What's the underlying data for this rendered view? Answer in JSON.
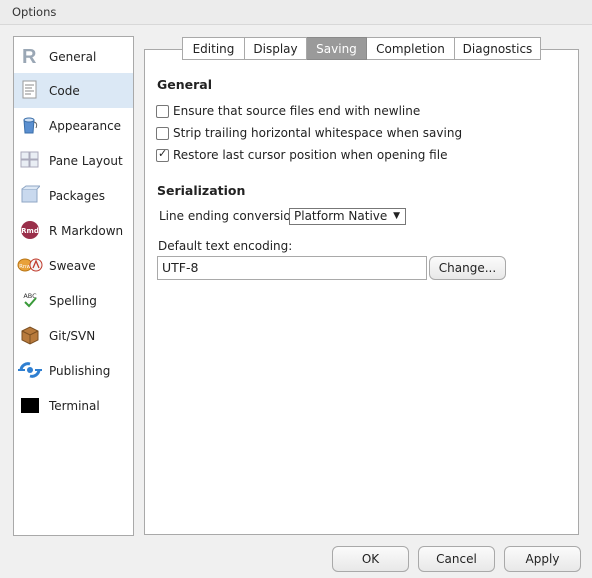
{
  "window": {
    "title": "Options"
  },
  "sidebar": {
    "items": [
      {
        "label": "General",
        "icon": "r-logo-icon",
        "selected": false
      },
      {
        "label": "Code",
        "icon": "code-document-icon",
        "selected": true
      },
      {
        "label": "Appearance",
        "icon": "appearance-bucket-icon",
        "selected": false
      },
      {
        "label": "Pane Layout",
        "icon": "pane-layout-icon",
        "selected": false
      },
      {
        "label": "Packages",
        "icon": "package-box-icon",
        "selected": false
      },
      {
        "label": "R Markdown",
        "icon": "rmd-icon",
        "selected": false
      },
      {
        "label": "Sweave",
        "icon": "sweave-icon",
        "selected": false
      },
      {
        "label": "Spelling",
        "icon": "spelling-abc-icon",
        "selected": false
      },
      {
        "label": "Git/SVN",
        "icon": "git-box-icon",
        "selected": false
      },
      {
        "label": "Publishing",
        "icon": "publishing-icon",
        "selected": false
      },
      {
        "label": "Terminal",
        "icon": "terminal-icon",
        "selected": false
      }
    ],
    "rmd_icon_text": "Rmd",
    "sweave_icon_text": "Rnw",
    "spelling_icon_text": "ABC"
  },
  "tabs": [
    {
      "label": "Editing",
      "active": false
    },
    {
      "label": "Display",
      "active": false
    },
    {
      "label": "Saving",
      "active": true
    },
    {
      "label": "Completion",
      "active": false
    },
    {
      "label": "Diagnostics",
      "active": false
    }
  ],
  "general": {
    "title": "General",
    "checks": [
      {
        "label": "Ensure that source files end with newline",
        "checked": false
      },
      {
        "label": "Strip trailing horizontal whitespace when saving",
        "checked": false
      },
      {
        "label": "Restore last cursor position when opening file",
        "checked": true
      }
    ],
    "tick": "✓"
  },
  "serialization": {
    "title": "Serialization",
    "line_ending_label": "Line ending conversion:",
    "line_ending_value": "Platform Native",
    "dropdown_arrow": "▼",
    "encoding_label": "Default text encoding:",
    "encoding_value": "UTF-8",
    "change_button": "Change..."
  },
  "footer": {
    "ok": "OK",
    "cancel": "Cancel",
    "apply": "Apply"
  },
  "colors": {
    "selected_bg": "#dbe8f5",
    "active_tab": "#9a9a9a"
  }
}
